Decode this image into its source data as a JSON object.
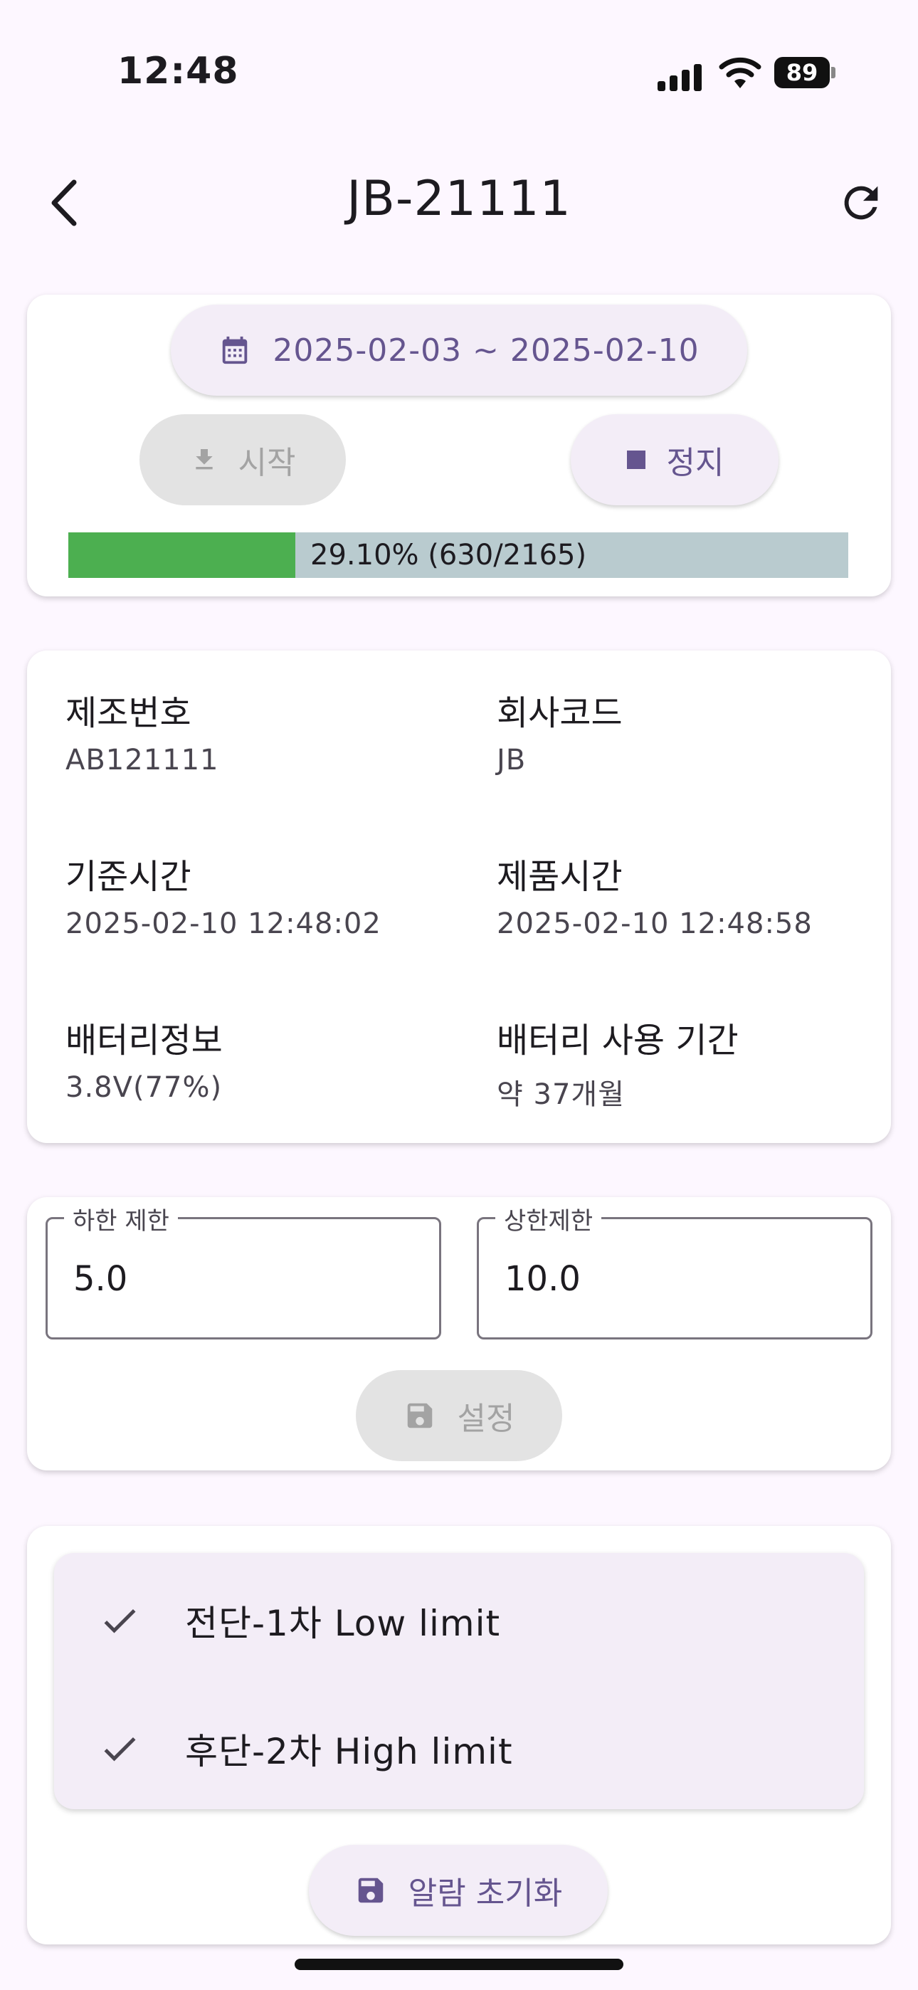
{
  "status_bar": {
    "time": "12:48",
    "battery": "89"
  },
  "app_bar": {
    "title": "JB-21111"
  },
  "download_card": {
    "date_range": "2025-02-03 ~ 2025-02-10",
    "start_label": "시작",
    "stop_label": "정지",
    "progress": {
      "fraction": 0.291,
      "text": "29.10% (630/2165)"
    }
  },
  "info": {
    "manufacture_no_label": "제조번호",
    "manufacture_no_value": "AB121111",
    "company_code_label": "회사코드",
    "company_code_value": "JB",
    "base_time_label": "기준시간",
    "base_time_value": "2025-02-10 12:48:02",
    "product_time_label": "제품시간",
    "product_time_value": "2025-02-10 12:48:58",
    "battery_info_label": "배터리정보",
    "battery_info_value": "3.8V(77%)",
    "battery_period_label": "배터리 사용 기간",
    "battery_period_value": "약 37개월"
  },
  "limits": {
    "low_label": "하한 제한",
    "low_value": "5.0",
    "high_label": "상한제한",
    "high_value": "10.0",
    "set_label": "설정"
  },
  "alarms": {
    "items": [
      {
        "label": "전단-1차 Low limit",
        "checked": true
      },
      {
        "label": "후단-2차 High limit",
        "checked": true
      }
    ],
    "reset_label": "알람 초기화"
  },
  "colors": {
    "accent": "#65558f",
    "progress_fill": "#4caf50",
    "progress_track": "#b9cbcf",
    "background": "#fdf7ff"
  },
  "icons": [
    "chevron-left-icon",
    "refresh-icon",
    "calendar-icon",
    "download-icon",
    "stop-icon",
    "save-icon",
    "check-icon"
  ]
}
